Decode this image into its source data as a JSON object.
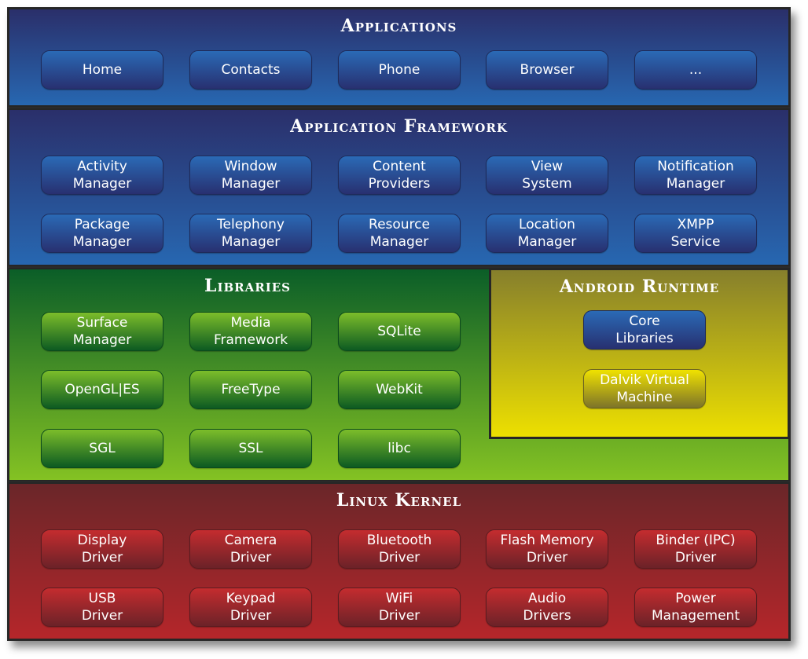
{
  "layers": {
    "applications": {
      "title": "Applications",
      "items": [
        "Home",
        "Contacts",
        "Phone",
        "Browser",
        "..."
      ]
    },
    "framework": {
      "title": "Application Framework",
      "items": [
        "Activity\nManager",
        "Window\nManager",
        "Content\nProviders",
        "View\nSystem",
        "Notification\nManager",
        "Package\nManager",
        "Telephony\nManager",
        "Resource\nManager",
        "Location\nManager",
        "XMPP\nService"
      ]
    },
    "libraries": {
      "title": "Libraries",
      "items": [
        "Surface\nManager",
        "Media\nFramework",
        "SQLite",
        "OpenGL|ES",
        "FreeType",
        "WebKit",
        "SGL",
        "SSL",
        "libc"
      ]
    },
    "runtime": {
      "title": "Android Runtime",
      "items": [
        "Core\nLibraries",
        "Dalvik Virtual\nMachine"
      ]
    },
    "kernel": {
      "title": "Linux Kernel",
      "items": [
        "Display\nDriver",
        "Camera\nDriver",
        "Bluetooth\nDriver",
        "Flash Memory\nDriver",
        "Binder (IPC)\nDriver",
        "USB\nDriver",
        "Keypad\nDriver",
        "WiFi\nDriver",
        "Audio\nDrivers",
        "Power\nManagement"
      ]
    }
  },
  "colors": {
    "applications": "#2a4f96",
    "framework": "#2a4f96",
    "libraries": "#3f8f25",
    "runtime": "#c4b810",
    "kernel": "#8f2529"
  }
}
